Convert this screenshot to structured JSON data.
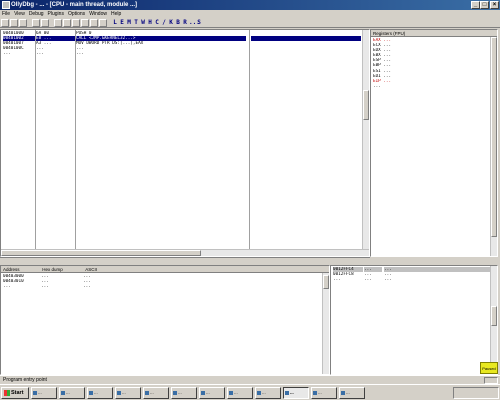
{
  "window": {
    "title": "OllyDbg - ... - [CPU - main thread, module ...]",
    "buttons": [
      "_",
      "□",
      "×"
    ]
  },
  "menu": [
    "File",
    "View",
    "Debug",
    "Plugins",
    "Options",
    "Window",
    "Help"
  ],
  "toolbar": {
    "buttons": [
      "open-icon",
      "restart-icon",
      "close-icon",
      "run-icon",
      "pause-icon",
      "step-into-icon",
      "step-over-icon",
      "trace-into-icon",
      "trace-over-icon",
      "execute-till-return-icon",
      "goto-icon"
    ],
    "letters": [
      "L",
      "E",
      "M",
      "T",
      "W",
      "H",
      "C",
      "/",
      "K",
      "B",
      "R",
      "...",
      "S"
    ]
  },
  "cpu": {
    "rows": [
      {
        "addr": "00401000",
        "hex": "6A 00",
        "dis": "PUSH 0",
        "cmt": ""
      },
      {
        "addr": "00401002",
        "hex": "E8 ...",
        "dis": "CALL <JMP.&KERNEL32...>",
        "cmt": ""
      },
      {
        "addr": "00401007",
        "hex": "A3 ...",
        "dis": "MOV DWORD PTR DS:[...],EAX",
        "cmt": ""
      },
      {
        "addr": "0040100C",
        "hex": "...",
        "dis": "...",
        "cmt": ""
      },
      {
        "addr": "...",
        "hex": "...",
        "dis": "...",
        "cmt": ""
      }
    ],
    "selected_index": 1
  },
  "registers": {
    "title": "Registers (FPU)",
    "lines": [
      {
        "text": "EAX ...",
        "cls": "red"
      },
      {
        "text": "ECX ...",
        "cls": ""
      },
      {
        "text": "EDX ...",
        "cls": ""
      },
      {
        "text": "EBX ...",
        "cls": ""
      },
      {
        "text": "ESP ...",
        "cls": ""
      },
      {
        "text": "EBP ...",
        "cls": ""
      },
      {
        "text": "ESI ...",
        "cls": ""
      },
      {
        "text": "EDI ...",
        "cls": ""
      },
      {
        "text": "EIP ...",
        "cls": "red"
      },
      {
        "text": "...",
        "cls": ""
      }
    ]
  },
  "info_line": "",
  "dump": {
    "header": [
      "Address",
      "Hex dump",
      "ASCII"
    ],
    "rows": [
      {
        "a": "00403000",
        "h": "...",
        "t": "..."
      },
      {
        "a": "00403010",
        "h": "...",
        "t": "..."
      },
      {
        "a": "...",
        "h": "...",
        "t": "..."
      }
    ]
  },
  "stack": {
    "rows": [
      {
        "a": "0012FFC4",
        "v": "...",
        "c": "...",
        "hl": true
      },
      {
        "a": "0012FFC8",
        "v": "...",
        "c": "...",
        "hl": false
      },
      {
        "a": "...",
        "v": "...",
        "c": "...",
        "hl": false
      }
    ]
  },
  "status": {
    "text": "Program entry point",
    "state": "Paused"
  },
  "taskbar": {
    "start": "Start",
    "tasks": [
      "...",
      "...",
      "...",
      "...",
      "...",
      "...",
      "...",
      "...",
      "...",
      "...",
      "...",
      "..."
    ],
    "active_index": 9,
    "clock": ""
  }
}
